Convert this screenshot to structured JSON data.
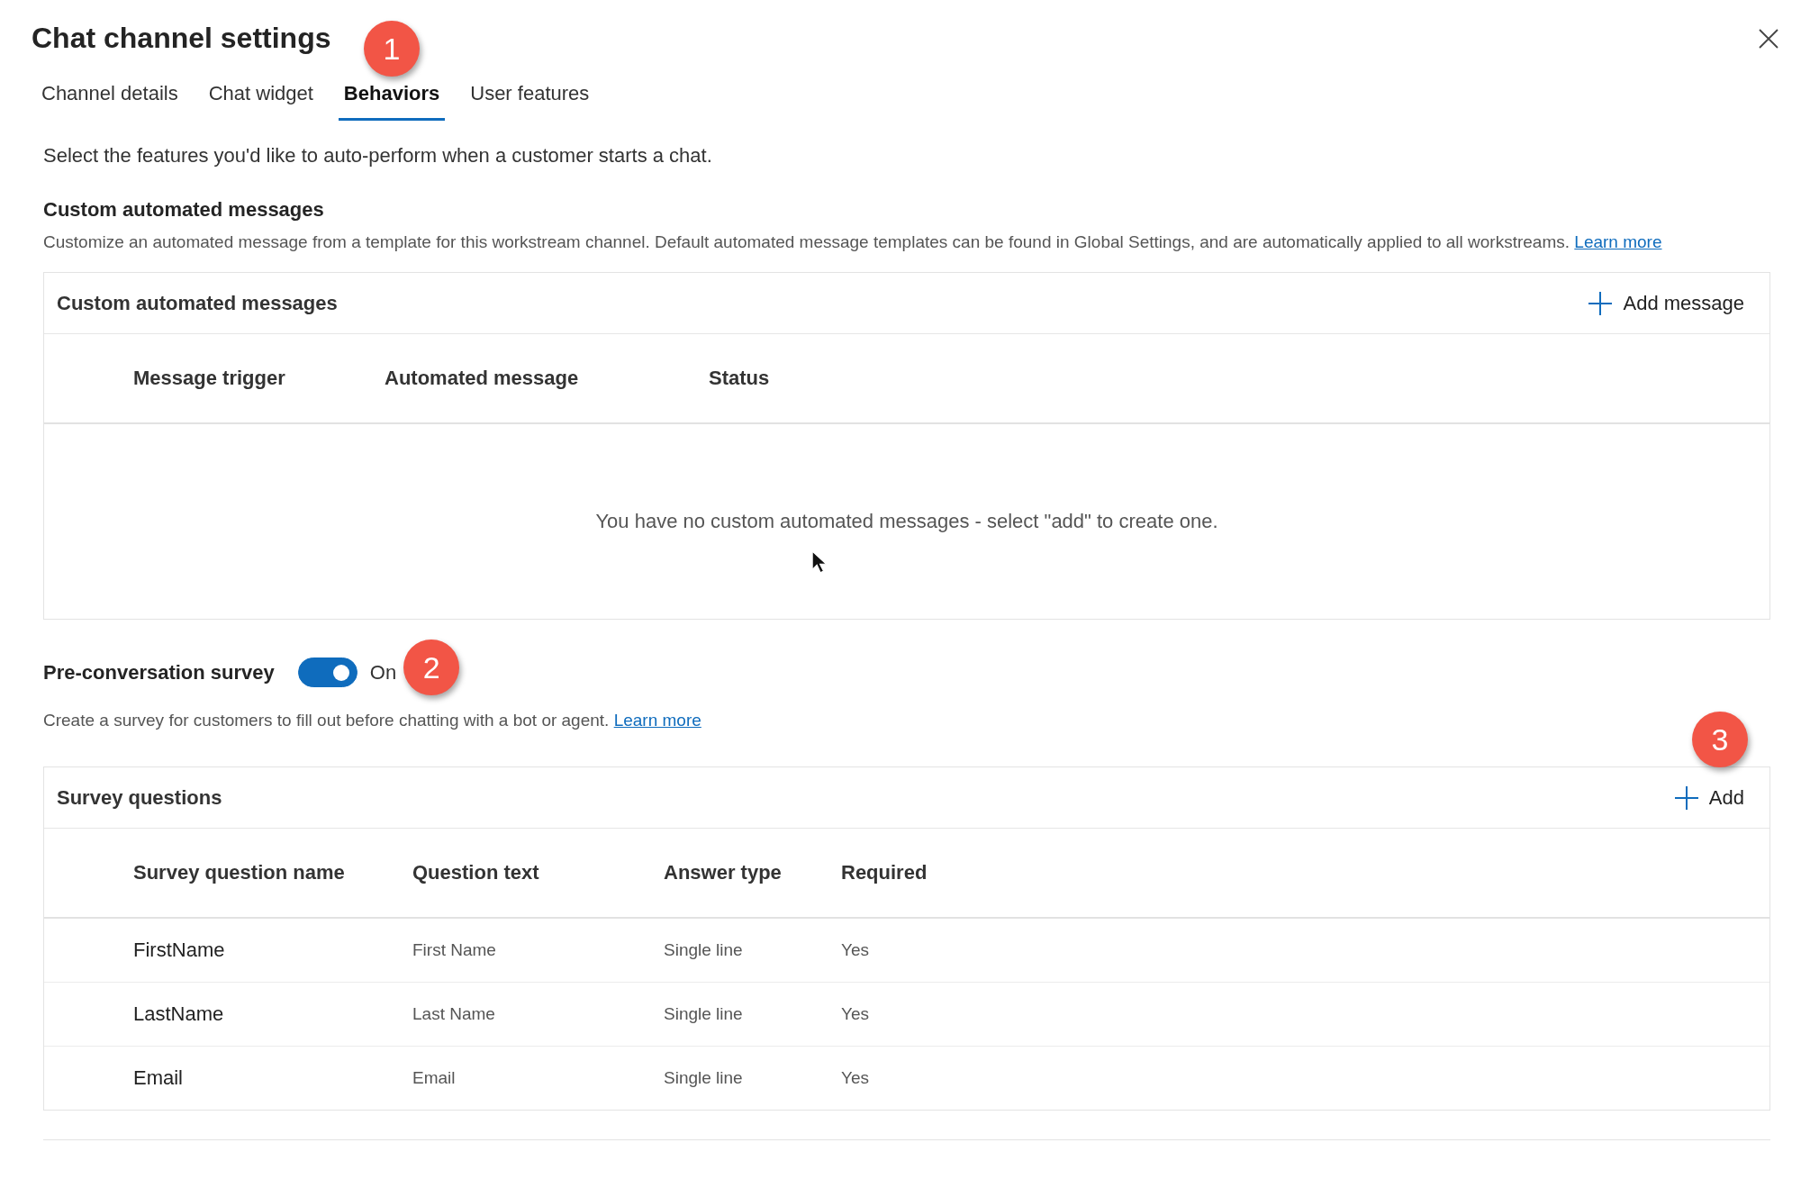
{
  "title": "Chat channel settings",
  "tabs": [
    {
      "label": "Channel details",
      "selected": false
    },
    {
      "label": "Chat widget",
      "selected": false
    },
    {
      "label": "Behaviors",
      "selected": true
    },
    {
      "label": "User features",
      "selected": false
    }
  ],
  "intro": "Select the features you'd like to auto-perform when a customer starts a chat.",
  "messages_section": {
    "heading": "Custom automated messages",
    "description": "Customize an automated message from a template for this workstream channel. Default automated message templates can be found in Global Settings, and are automatically applied to all workstreams.",
    "link": "Learn more",
    "table": {
      "title": "Custom automated messages",
      "add_button": "Add message",
      "columns": [
        "Message trigger",
        "Automated message",
        "Status"
      ],
      "empty_message": "You have no custom automated messages - select \"add\" to create one."
    }
  },
  "survey_section": {
    "label": "Pre-conversation survey",
    "toggle": {
      "on": true,
      "label": "On"
    },
    "description": "Create a survey for customers to fill out before chatting with a bot or agent.",
    "link": "Learn more",
    "table": {
      "title": "Survey questions",
      "add_button": "Add",
      "columns": [
        "Survey question name",
        "Question text",
        "Answer type",
        "Required"
      ],
      "rows": [
        {
          "name": "FirstName",
          "question_text": "First Name",
          "answer_type": "Single line",
          "required": "Yes"
        },
        {
          "name": "LastName",
          "question_text": "Last Name",
          "answer_type": "Single line",
          "required": "Yes"
        },
        {
          "name": "Email",
          "question_text": "Email",
          "answer_type": "Single line",
          "required": "Yes"
        }
      ]
    }
  },
  "callouts": [
    "1",
    "2",
    "3"
  ]
}
